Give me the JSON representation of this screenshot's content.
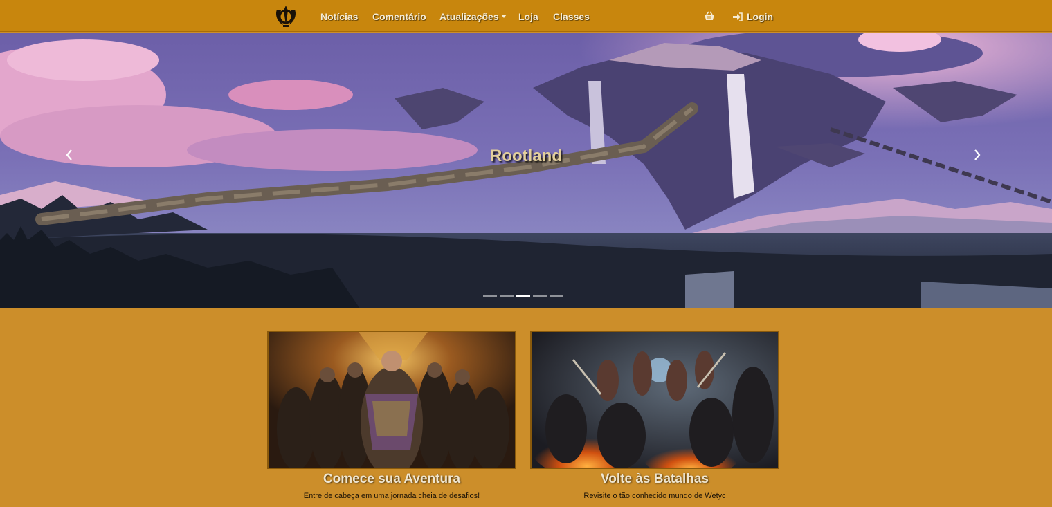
{
  "nav": {
    "logo_icon": "khanda-emblem-icon",
    "links": [
      "Notícias",
      "Comentário",
      "Atualizações",
      "Loja",
      "Classes"
    ],
    "cart_icon": "basket-icon",
    "login_label": "Login",
    "login_icon": "sign-in-icon"
  },
  "hero": {
    "title": "Rootland",
    "prev_icon": "chevron-left-icon",
    "next_icon": "chevron-right-icon",
    "slide_count": 5,
    "active_slide": 3
  },
  "cards": [
    {
      "title": "Comece sua Aventura",
      "text": "Entre de cabeça em uma jornada cheia de desafios!"
    },
    {
      "title": "Volte às Batalhas",
      "text": "Revisite o tão conhecido mundo de Wetyc"
    }
  ],
  "colors": {
    "navbar": "#c8860d",
    "page": "#cc8e2a",
    "hero_title": "#e3cf9c"
  }
}
